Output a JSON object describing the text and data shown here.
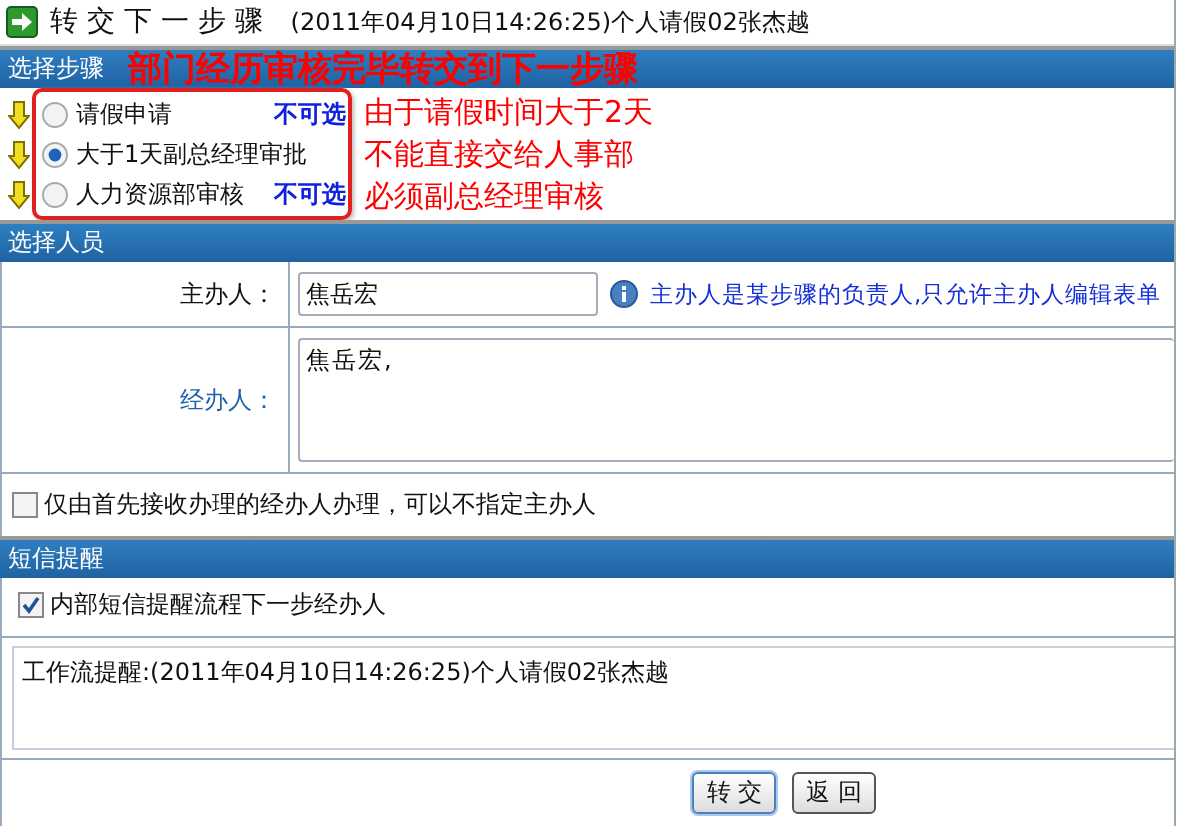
{
  "header": {
    "title": "转 交 下 一 步 骤",
    "subtitle": "(2011年04月10日14:26:25)个人请假02张杰越"
  },
  "step_section": {
    "title": "选择步骤",
    "annotation": "部门经历审核完毕转交到下一步骤"
  },
  "steps": [
    {
      "label": "请假申请",
      "selected": false,
      "note": "不可选"
    },
    {
      "label": "大于1天副总经理审批",
      "selected": true
    },
    {
      "label": "人力资源部审核",
      "selected": false,
      "note": "不可选"
    }
  ],
  "step_annotations": [
    "由于请假时间大于2天",
    "不能直接交给人事部",
    "必须副总经理审核"
  ],
  "people_section": {
    "title": "选择人员"
  },
  "host": {
    "label": "主办人：",
    "value": "焦岳宏",
    "hint": "主办人是某步骤的负责人,只允许主办人编辑表单"
  },
  "handlers": {
    "label": "经办人：",
    "value": "焦岳宏,"
  },
  "first_receiver": {
    "label": "仅由首先接收办理的经办人办理，可以不指定主办人",
    "checked": false
  },
  "sms_section": {
    "title": "短信提醒"
  },
  "sms_notify": {
    "label": "内部短信提醒流程下一步经办人",
    "checked": true
  },
  "message": {
    "value": "工作流提醒:(2011年04月10日14:26:25)个人请假02张杰越"
  },
  "buttons": [
    {
      "label": "转 交"
    },
    {
      "label": "返 回"
    }
  ]
}
